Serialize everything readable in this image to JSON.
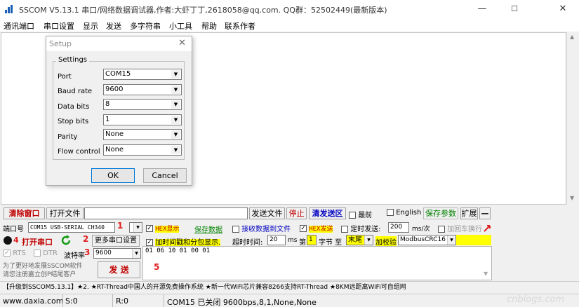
{
  "window": {
    "title": "SSCOM V5.13.1 串口/网络数据调试器,作者:大虾丁丁,2618058@qq.com. QQ群：52502449(最新版本)",
    "min": "—",
    "max": "☐",
    "close": "✕"
  },
  "menu": [
    "通讯端口",
    "串口设置",
    "显示",
    "发送",
    "多字符串",
    "小工具",
    "帮助",
    "联系作者"
  ],
  "dialog": {
    "title": "Setup",
    "group": "Settings",
    "fields": [
      {
        "label": "Port",
        "value": "COM15"
      },
      {
        "label": "Baud rate",
        "value": "9600"
      },
      {
        "label": "Data bits",
        "value": "8"
      },
      {
        "label": "Stop bits",
        "value": "1"
      },
      {
        "label": "Parity",
        "value": "None"
      },
      {
        "label": "Flow control",
        "value": "None"
      }
    ],
    "ok": "OK",
    "cancel": "Cancel"
  },
  "toolbar": {
    "clear": "清除窗口",
    "open_file": "打开文件",
    "send_file": "发送文件",
    "stop": "停止",
    "clear_send": "清发送区",
    "topmost": "最前",
    "english": "English",
    "save_params": "保存参数",
    "expand": "扩展",
    "collapse": "—"
  },
  "port": {
    "label": "端口号",
    "value": "COM15 USB-SERIAL CH340",
    "num1": "1",
    "num2": "2",
    "num3": "3",
    "num4": "4",
    "num5": "5",
    "more_settings": "更多串口设置",
    "open_port": "打开串口",
    "rts": "RTS",
    "dtr": "DTR",
    "baud_label": "波特率",
    "baud_value": "9600"
  },
  "options": {
    "hex_show": "HEX显示",
    "save_data": "保存数据",
    "recv_to_file": "接收数据到文件",
    "hex_send": "HEX发送",
    "timed_send": "定时发送:",
    "interval": "200",
    "interval_unit": "ms/次",
    "add_crlf": "加回车换行",
    "add_timestamp": "加时间戳和分包显示.",
    "timeout_label": "超时时间:",
    "timeout_value": "20",
    "timeout_unit": "ms",
    "byte_label_1": "第",
    "byte_value": "1",
    "byte_label_2": "字节 至",
    "end_value": "末尾",
    "checksum_label": "加校验",
    "checksum_value": "ModbusCRC16"
  },
  "send": {
    "content": "01 06 10 01 00 01",
    "button": "发 送",
    "promo": "为了更好地发展SSCOM软件\n请您注册嘉立创P结尾客户"
  },
  "ticker": "【升级到SSCOM5.13.1】★2. ★RT-Thread中国人的开源免费操作系统 ★新一代WiFi芯片兼容8266支持RT-Thread ★8KM远距离WiFi可自组网",
  "status": {
    "url": "www.daxia.com",
    "s": "S:0",
    "r": "R:0",
    "info": "COM15 已关闭  9600bps,8,1,None,None"
  },
  "watermark": "cnblogs.com"
}
